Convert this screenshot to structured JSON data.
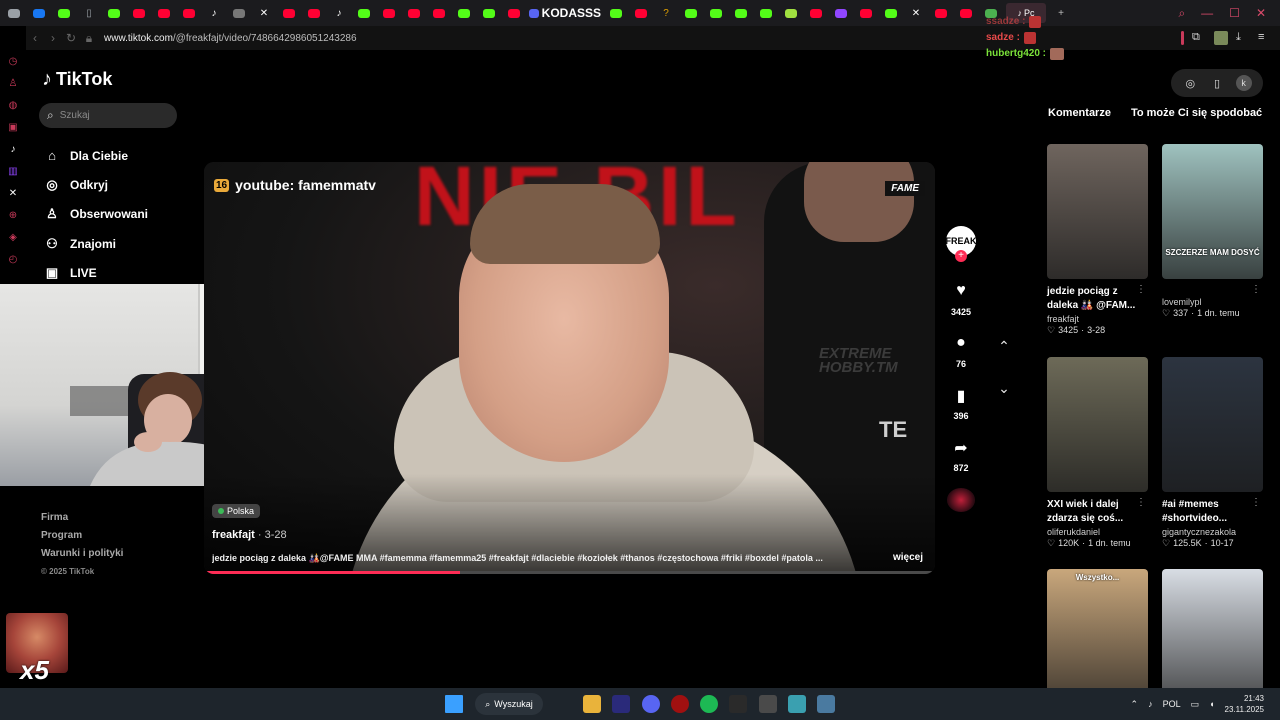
{
  "browser": {
    "url_host": "www.tiktok.com",
    "url_path": "/@freakfajt/video/7486642986051243286",
    "tab_label": "KODASSS",
    "active_tab_label": "Pc",
    "tabs": [
      {
        "icon": "window-icon",
        "color": "#9aa0a6"
      },
      {
        "icon": "facebook-icon",
        "color": "#1877f2"
      },
      {
        "icon": "kick-icon",
        "color": "#53fc18"
      },
      {
        "icon": "page-icon",
        "color": "#9aa0a6"
      },
      {
        "icon": "kick-icon",
        "color": "#53fc18"
      },
      {
        "icon": "youtube-icon",
        "color": "#ff0033"
      },
      {
        "icon": "youtube-icon",
        "color": "#ff0033"
      },
      {
        "icon": "youtube-icon",
        "color": "#ff0033"
      },
      {
        "icon": "tiktok-icon",
        "color": "#ffffff"
      },
      {
        "icon": "app-icon",
        "color": "#777777"
      },
      {
        "icon": "x-icon",
        "color": "#ffffff"
      },
      {
        "icon": "youtube-icon",
        "color": "#ff0033"
      },
      {
        "icon": "youtube-icon",
        "color": "#ff0033"
      },
      {
        "icon": "tiktok-icon",
        "color": "#ffffff"
      },
      {
        "icon": "kick-icon",
        "color": "#53fc18"
      },
      {
        "icon": "youtube-icon",
        "color": "#ff0033"
      },
      {
        "icon": "youtube-icon",
        "color": "#ff0033"
      },
      {
        "icon": "youtube-icon",
        "color": "#ff0033"
      },
      {
        "icon": "kick-icon",
        "color": "#53fc18"
      },
      {
        "icon": "kick-icon",
        "color": "#53fc18"
      },
      {
        "icon": "youtube-icon",
        "color": "#ff0033"
      }
    ],
    "tabs_right": [
      {
        "icon": "kick-icon",
        "color": "#53fc18"
      },
      {
        "icon": "youtube-icon",
        "color": "#ff0033"
      },
      {
        "icon": "help-icon",
        "color": "#e0a000"
      },
      {
        "icon": "kick-icon",
        "color": "#53fc18"
      },
      {
        "icon": "kick-icon",
        "color": "#53fc18"
      },
      {
        "icon": "kick-icon",
        "color": "#53fc18"
      },
      {
        "icon": "kick-icon",
        "color": "#53fc18"
      },
      {
        "icon": "grid-icon",
        "color": "#a0e040"
      },
      {
        "icon": "youtube-icon",
        "color": "#ff0033"
      },
      {
        "icon": "twitch-icon",
        "color": "#9146ff"
      },
      {
        "icon": "youtube-icon",
        "color": "#ff0033"
      },
      {
        "icon": "kick-icon",
        "color": "#53fc18"
      },
      {
        "icon": "x-icon",
        "color": "#ffffff"
      },
      {
        "icon": "youtube-icon",
        "color": "#ff0033"
      },
      {
        "icon": "youtube-icon",
        "color": "#ff0033"
      },
      {
        "icon": "chrome-icon",
        "color": "#4caf50"
      }
    ]
  },
  "chat": [
    {
      "user": "sadze :",
      "color": "#e84a4a"
    },
    {
      "user": "hubertg420 :",
      "color": "#7be33a"
    }
  ],
  "tiktok": {
    "logo": "TikTok",
    "search_placeholder": "Szukaj",
    "nav": [
      {
        "label": "Dla Ciebie",
        "icon": "home-icon"
      },
      {
        "label": "Odkryj",
        "icon": "compass-icon"
      },
      {
        "label": "Obserwowani",
        "icon": "following-icon"
      },
      {
        "label": "Znajomi",
        "icon": "friends-icon"
      },
      {
        "label": "LIVE",
        "icon": "live-icon"
      }
    ],
    "footer": [
      "Firma",
      "Program",
      "Warunki i polityki"
    ],
    "copyright": "© 2025 TikTok",
    "right_tabs": [
      "Komentarze",
      "To może Ci się spodobać"
    ],
    "profile_initial": "k"
  },
  "video": {
    "overlay_num": "16",
    "overlay_text": "youtube: famemmatv",
    "brand": "FAME",
    "sign_text": "NIE BIL",
    "shirt_logo": "EXTREME HOBBY.TM",
    "shirt_text": "TE",
    "location": "Polska",
    "author": "freakfajt",
    "date": "3-28",
    "description": "jedzie pociąg z daleka 🎎@FAME MMA #famemma #famemma25 #freakfajt #dlaciebie #koziołek #thanos #częstochowa #friki #boxdel #patola ...",
    "more": "więcej",
    "progress": 0.35,
    "avatar_text": "FREAK",
    "likes": "3425",
    "comments": "76",
    "saves": "396",
    "shares": "872"
  },
  "recommended": [
    {
      "title": "jedzie pociąg z daleka 🎎 @FAM...",
      "author": "freakfajt",
      "likes": "3425",
      "date": "3-28",
      "thumb": "#6f655e",
      "thumb_text": ""
    },
    {
      "title": "",
      "author": "lovemilypl",
      "likes": "337",
      "date": "1 dn. temu",
      "thumb": "#9fc2bf",
      "thumb_text": "SZCZERZE MAM DOSYĆ"
    },
    {
      "title": "XXI wiek i dalej zdarza się coś...",
      "author": "oliferukdaniel",
      "likes": "120K",
      "date": "1 dn. temu",
      "thumb": "#6d6a58",
      "thumb_text": ""
    },
    {
      "title": "#ai #memes #shortvideo...",
      "author": "gigantycznezakola",
      "likes": "125.5K",
      "date": "10-17",
      "thumb": "#2c3440",
      "thumb_text": ""
    },
    {
      "title": "",
      "author": "",
      "likes": "",
      "date": "",
      "thumb": "#c9a77c",
      "thumb_text": "Wszystko..."
    },
    {
      "title": "",
      "author": "",
      "likes": "",
      "date": "",
      "thumb": "#d8dde4",
      "thumb_text": ""
    }
  ],
  "stream": {
    "multiplier": "x5"
  },
  "taskbar": {
    "search_label": "Wyszukaj",
    "lang": "POL",
    "time": "21:43",
    "date": "23.11.2025",
    "apps": [
      {
        "name": "start-icon",
        "color": "#3aa0ff"
      },
      {
        "name": "file-explorer-icon",
        "color": "#e9b33b"
      },
      {
        "name": "premiere-icon",
        "color": "#2a2a7a"
      },
      {
        "name": "discord-icon",
        "color": "#5865f2"
      },
      {
        "name": "obs-icon",
        "color": "#a01010"
      },
      {
        "name": "spotify-icon",
        "color": "#1db954"
      },
      {
        "name": "app-icon",
        "color": "#2a2a2a"
      },
      {
        "name": "chrome-icon",
        "color": "#4a4a4a"
      },
      {
        "name": "globe-icon",
        "color": "#3aa0b0"
      },
      {
        "name": "calculator-icon",
        "color": "#4a7aa0"
      }
    ]
  }
}
